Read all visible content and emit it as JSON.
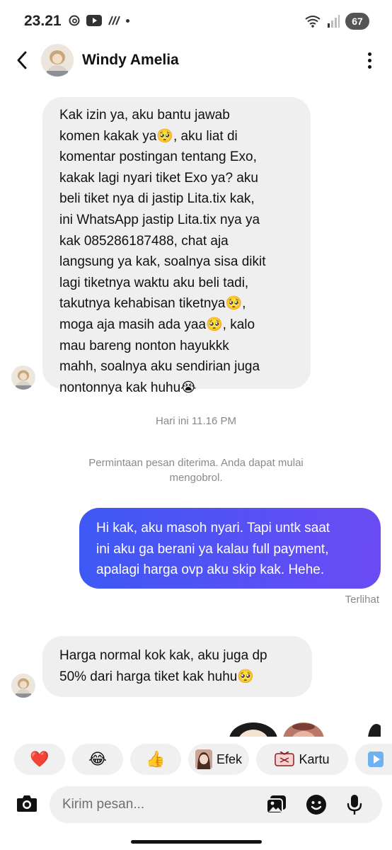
{
  "status_bar": {
    "time": "23.21",
    "battery": "67"
  },
  "header": {
    "contact_name": "Windy Amelia"
  },
  "messages": [
    {
      "direction": "incoming",
      "lines": [
        "Kak izin ya, aku bantu jawab",
        "komen kakak ya🥺, aku liat di",
        "komentar postingan tentang Exo,",
        "kakak lagi nyari tiket Exo ya? aku",
        "beli tiket nya di jastip Lita.tix kak,",
        "ini WhatsApp jastip Lita.tix nya ya",
        "kak 085286187488, chat aja",
        "langsung ya kak, soalnya sisa dikit",
        "lagi tiketnya waktu aku beli tadi,",
        "takutnya kehabisan tiketnya🥺,",
        "moga aja masih ada yaa🥺, kalo",
        "mau bareng nonton hayukkk",
        "mahh, soalnya aku sendirian juga",
        "nontonnya kak huhu😭"
      ]
    },
    {
      "direction": "outgoing",
      "lines": [
        "Hi kak, aku masoh nyari. Tapi untk saat",
        "ini aku ga berani ya kalau full payment,",
        "apalagi harga ovp aku skip kak. Hehe."
      ]
    },
    {
      "direction": "incoming",
      "lines": [
        "Harga normal kok kak, aku juga dp",
        "50% dari harga tiket kak huhu🥺"
      ]
    }
  ],
  "timestamp": "Hari ini 11.16 PM",
  "system_notice": {
    "line1": "Permintaan pesan diterima. Anda dapat mulai",
    "line2": "mengobrol."
  },
  "seen_label": "Terlihat",
  "quick_reactions": [
    {
      "emoji": "❤️"
    },
    {
      "emoji": "😂"
    },
    {
      "emoji": "👍"
    },
    {
      "label": "Efek"
    },
    {
      "label": "Kartu"
    }
  ],
  "composer": {
    "placeholder": "Kirim pesan..."
  },
  "colors": {
    "outgoing_bubble_start": "#3d59f5",
    "outgoing_bubble_end": "#6b4bf3",
    "incoming_bubble": "#efeff0",
    "chip_background": "#f0f0f1"
  }
}
